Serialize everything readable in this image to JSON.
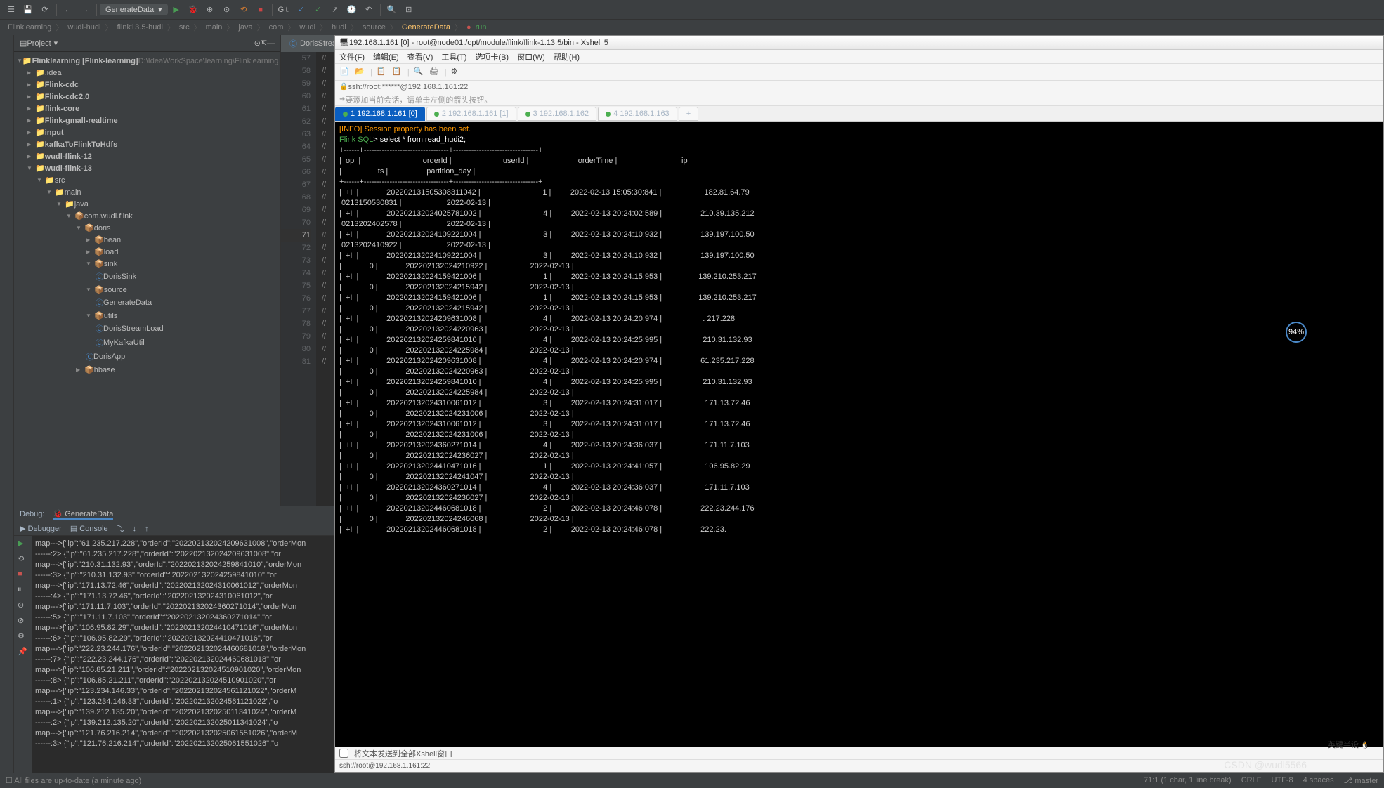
{
  "toolbar": {
    "run_config": "GenerateData",
    "git_label": "Git:"
  },
  "breadcrumb": {
    "items": [
      "Flinklearning",
      "wudl-hudi",
      "flink13.5-hudi",
      "src",
      "main",
      "java",
      "com",
      "wudl",
      "hudi",
      "source"
    ],
    "current": "GenerateData",
    "run": "run"
  },
  "project": {
    "title": "Project",
    "root": "Flinklearning [Flink-learning]",
    "root_path": "D:\\IdeaWorkSpace\\learning\\Flinklearning",
    "nodes": [
      ".idea",
      "Flink-cdc",
      "Flink-cdc2.0",
      "flink-core",
      "Flink-gmall-realtime",
      "input",
      "kafkaToFlinkToHdfs",
      "wudl-flink-12",
      "wudl-flink-13"
    ],
    "src": "src",
    "main": "main",
    "java": "java",
    "pkg": "com.wudl.flink",
    "doris": "doris",
    "doris_children": [
      "bean",
      "load",
      "sink",
      "source",
      "utils"
    ],
    "sink_child": "DorisSink",
    "source_child": "GenerateData",
    "utils_children": [
      "DorisStreamLoad",
      "MyKafkaUtil"
    ],
    "doris_app": "DorisApp",
    "hbase": "hbase"
  },
  "editor": {
    "tab": "DorisStreamL...",
    "lines": [
      "57",
      "58",
      "59",
      "60",
      "61",
      "62",
      "63",
      "64",
      "65",
      "66",
      "67",
      "68",
      "69",
      "70",
      "71",
      "72",
      "73",
      "74",
      "75",
      "76",
      "77",
      "78",
      "79",
      "80",
      "81"
    ],
    "highlight_line": "71",
    "code_comment": "//"
  },
  "debug": {
    "title": "Debug:",
    "config": "GenerateData",
    "tab_debugger": "Debugger",
    "tab_console": "Console",
    "console_lines": [
      "map--->{\"ip\":\"61.235.217.228\",\"orderId\":\"202202132024209631008\",\"orderMon",
      "------:2> {\"ip\":\"61.235.217.228\",\"orderId\":\"202202132024209631008\",\"or",
      "map--->{\"ip\":\"210.31.132.93\",\"orderId\":\"202202132024259841010\",\"orderMon",
      "------:3> {\"ip\":\"210.31.132.93\",\"orderId\":\"202202132024259841010\",\"or",
      "map--->{\"ip\":\"171.13.72.46\",\"orderId\":\"202202132024310061012\",\"orderMon",
      "------:4> {\"ip\":\"171.13.72.46\",\"orderId\":\"202202132024310061012\",\"or",
      "map--->{\"ip\":\"171.11.7.103\",\"orderId\":\"202202132024360271014\",\"orderMon",
      "------:5> {\"ip\":\"171.11.7.103\",\"orderId\":\"202202132024360271014\",\"or",
      "map--->{\"ip\":\"106.95.82.29\",\"orderId\":\"202202132024410471016\",\"orderMon",
      "------:6> {\"ip\":\"106.95.82.29\",\"orderId\":\"202202132024410471016\",\"or",
      "map--->{\"ip\":\"222.23.244.176\",\"orderId\":\"202202132024460681018\",\"orderMon",
      "------:7> {\"ip\":\"222.23.244.176\",\"orderId\":\"202202132024460681018\",\"or",
      "map--->{\"ip\":\"106.85.21.211\",\"orderId\":\"202202132024510901020\",\"orderMon",
      "------:8> {\"ip\":\"106.85.21.211\",\"orderId\":\"202202132024510901020\",\"or",
      "map--->{\"ip\":\"123.234.146.33\",\"orderId\":\"202202132024561121022\",\"orderM",
      "------:1> {\"ip\":\"123.234.146.33\",\"orderId\":\"202202132024561121022\",\"o",
      "map--->{\"ip\":\"139.212.135.20\",\"orderId\":\"202202132025011341024\",\"orderM",
      "------:2> {\"ip\":\"139.212.135.20\",\"orderId\":\"202202132025011341024\",\"o",
      "map--->{\"ip\":\"121.76.216.214\",\"orderId\":\"202202132025061551026\",\"orderM",
      "------:3> {\"ip\":\"121.76.216.214\",\"orderId\":\"202202132025061551026\",\"o"
    ]
  },
  "xshell": {
    "title": "192.168.1.161 [0] - root@node01:/opt/module/flink/flink-1.13.5/bin - Xshell 5",
    "menu": [
      "文件(F)",
      "编辑(E)",
      "查看(V)",
      "工具(T)",
      "选项卡(B)",
      "窗口(W)",
      "帮助(H)"
    ],
    "addr": "ssh://root:******@192.168.1.161:22",
    "hint": "要添加当前会话，请单击左侧的箭头按钮。",
    "tabs": [
      {
        "label": "1 192.168.1.161 [0]",
        "active": true
      },
      {
        "label": "2 192.168.1.161 [1]",
        "active": false
      },
      {
        "label": "3 192.168.1.162",
        "active": false
      },
      {
        "label": "4 192.168.1.163",
        "active": false
      }
    ],
    "info_line": "[INFO] Session property has been set.",
    "prompt": "Flink SQL",
    "cmd": "> select * from read_hudi2;",
    "header1": "|  op  |                             orderId |                        userId |                       orderTime |                              ip",
    "header2": "|                 ts |                  partition_day |",
    "rows": [
      "|  +I  |             202202131505308311042 |                             1 |         2022-02-13 15:05:30:841 |                    182.81.64.79",
      " 0213150530831 |                     2022-02-13 |",
      "|  +I  |             202202132024025781002 |                             4 |         2022-02-13 20:24:02:589 |                  210.39.135.212",
      " 0213202402578 |                     2022-02-13 |",
      "|  +I  |             202202132024109221004 |                             3 |         2022-02-13 20:24:10:932 |                  139.197.100.50",
      " 0213202410922 |                     2022-02-13 |",
      "|  +I  |             202202132024109221004 |                             3 |         2022-02-13 20:24:10:932 |                  139.197.100.50",
      "|             0 |             202202132024210922 |                    2022-02-13 |",
      "|  +I  |             202202132024159421006 |                             1 |         2022-02-13 20:24:15:953 |                 139.210.253.217",
      "|             0 |             202202132024215942 |                    2022-02-13 |",
      "|  +I  |             202202132024159421006 |                             1 |         2022-02-13 20:24:15:953 |                 139.210.253.217",
      "|             0 |             202202132024215942 |                    2022-02-13 |",
      "|  +I  |             202202132024209631008 |                             4 |         2022-02-13 20:24:20:974 |                   . 217.228",
      "|             0 |             202202132024220963 |                    2022-02-13 |",
      "|  +I  |             202202132024259841010 |                             4 |         2022-02-13 20:24:25:995 |                   210.31.132.93",
      "|             0 |             202202132024225984 |                    2022-02-13 |",
      "|  +I  |             202202132024209631008 |                             4 |         2022-02-13 20:24:20:974 |                  61.235.217.228",
      "|             0 |             202202132024220963 |                    2022-02-13 |",
      "|  +I  |             202202132024259841010 |                             4 |         2022-02-13 20:24:25:995 |                   210.31.132.93",
      "|             0 |             202202132024225984 |                    2022-02-13 |",
      "|  +I  |             202202132024310061012 |                             3 |         2022-02-13 20:24:31:017 |                    171.13.72.46",
      "|             0 |             202202132024231006 |                    2022-02-13 |",
      "|  +I  |             202202132024310061012 |                             3 |         2022-02-13 20:24:31:017 |                    171.13.72.46",
      "|             0 |             202202132024231006 |                    2022-02-13 |",
      "|  +I  |             202202132024360271014 |                             4 |         2022-02-13 20:24:36:037 |                    171.11.7.103",
      "|             0 |             202202132024236027 |                    2022-02-13 |",
      "|  +I  |             202202132024410471016 |                             1 |         2022-02-13 20:24:41:057 |                    106.95.82.29",
      "|             0 |             202202132024241047 |                    2022-02-13 |",
      "|  +I  |             202202132024360271014 |                             4 |         2022-02-13 20:24:36:037 |                    171.11.7.103",
      "|             0 |             202202132024236027 |                    2022-02-13 |",
      "|  +I  |             202202132024460681018 |                             2 |         2022-02-13 20:24:46:078 |                  222.23.244.176",
      "|             0 |             202202132024246068 |                    2022-02-13 |",
      "|  +I  |             202202132024460681018 |                             2 |         2022-02-13 20:24:46:078 |                  222.23."
    ],
    "footer_check": "将文本发送到全部Xshell窗口",
    "status": "ssh://root@192.168.1.161:22"
  },
  "status": {
    "left": "All files are up-to-date (a minute ago)",
    "pos": "71:1 (1 char, 1 line break)",
    "crlf": "CRLF",
    "enc": "UTF-8",
    "spaces": "4 spaces",
    "branch": "master"
  },
  "badge": "94%",
  "watermark": "CSDN @wudl5566",
  "mascot_text": "英键半设"
}
